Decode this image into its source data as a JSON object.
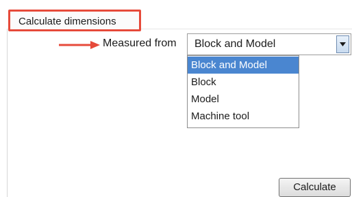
{
  "section": {
    "title": "Calculate dimensions"
  },
  "measured_from": {
    "label": "Measured from",
    "selected_value": "Block and Model",
    "options": [
      "Block and Model",
      "Block",
      "Model",
      "Machine tool"
    ],
    "highlighted_option": "Block and Model"
  },
  "actions": {
    "calculate_label": "Calculate"
  },
  "colors": {
    "highlight_border": "#e64a3a",
    "arrow": "#e64a3a",
    "selection": "#4a86d0"
  },
  "icons": {
    "arrow": "right-arrow-icon",
    "dropdown": "chevron-down-icon"
  }
}
